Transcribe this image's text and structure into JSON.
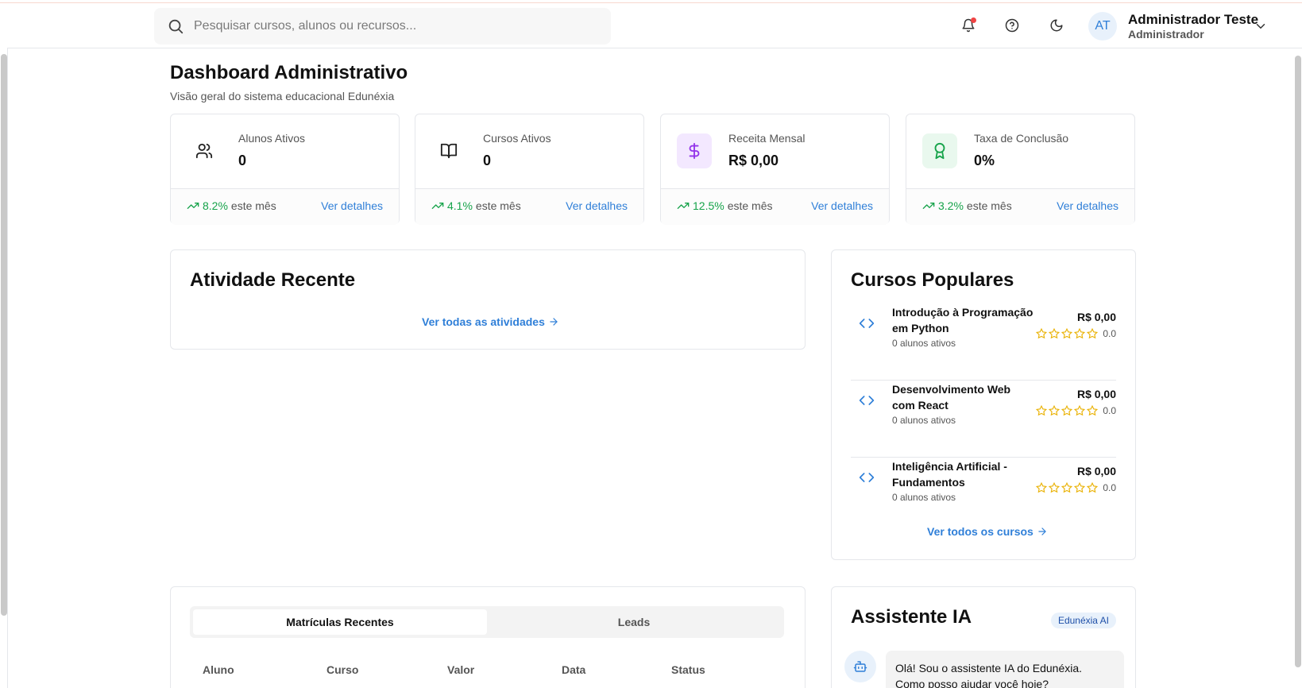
{
  "search": {
    "placeholder": "Pesquisar cursos, alunos ou recursos..."
  },
  "header": {
    "avatar_initials": "AT",
    "user_name": "Administrador Teste",
    "user_role": "Administrador"
  },
  "page": {
    "title": "Dashboard Administrativo",
    "subtitle": "Visão geral do sistema educacional Edunéxia"
  },
  "stats": [
    {
      "label": "Alunos Ativos",
      "value": "0",
      "trend": "8.2%",
      "trend_suffix": "este mês",
      "link": "Ver detalhes",
      "icon": "users-icon"
    },
    {
      "label": "Cursos Ativos",
      "value": "0",
      "trend": "4.1%",
      "trend_suffix": "este mês",
      "link": "Ver detalhes",
      "icon": "book-open-icon"
    },
    {
      "label": "Receita Mensal",
      "value": "R$ 0,00",
      "trend": "12.5%",
      "trend_suffix": "este mês",
      "link": "Ver detalhes",
      "icon": "dollar-icon"
    },
    {
      "label": "Taxa de Conclusão",
      "value": "0%",
      "trend": "3.2%",
      "trend_suffix": "este mês",
      "link": "Ver detalhes",
      "icon": "award-icon"
    }
  ],
  "recent_activity": {
    "title": "Atividade Recente",
    "link": "Ver todas as atividades"
  },
  "popular_courses": {
    "title": "Cursos Populares",
    "items": [
      {
        "name": "Introdução à Programação em Python",
        "students": "0 alunos ativos",
        "price": "R$ 0,00",
        "rating": "0.0"
      },
      {
        "name": "Desenvolvimento Web com React",
        "students": "0 alunos ativos",
        "price": "R$ 0,00",
        "rating": "0.0"
      },
      {
        "name": "Inteligência Artificial - Fundamentos",
        "students": "0 alunos ativos",
        "price": "R$ 0,00",
        "rating": "0.0"
      }
    ],
    "link": "Ver todos os cursos"
  },
  "enrollments": {
    "tabs": [
      "Matrículas Recentes",
      "Leads"
    ],
    "columns": [
      "Aluno",
      "Curso",
      "Valor",
      "Data",
      "Status"
    ]
  },
  "assistant": {
    "title": "Assistente IA",
    "badge": "Edunéxia AI",
    "message": "Olá! Sou o assistente IA do Edunéxia. Como posso ajudar você hoje?"
  },
  "colors": {
    "accent": "#2f7fd8",
    "trend_up": "#16a34a",
    "notification": "#ef4444",
    "revenue_icon": "#9333ea",
    "completion_icon": "#16a34a",
    "star": "#eab308"
  }
}
